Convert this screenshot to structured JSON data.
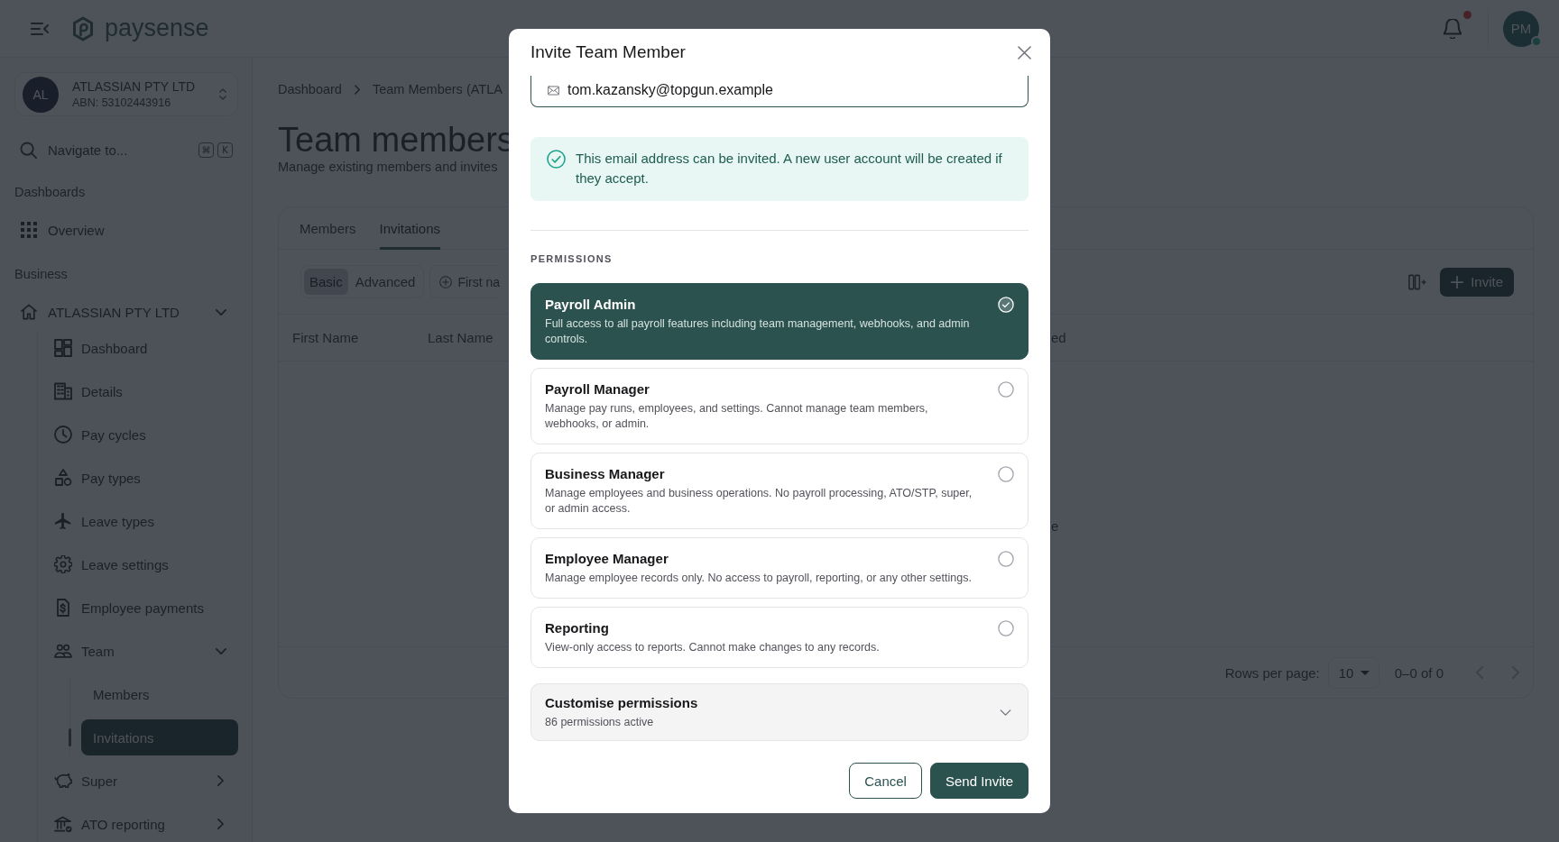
{
  "topbar": {
    "logo_text": "paysense",
    "notifications": {
      "unread": true
    },
    "user": {
      "initials": "PM",
      "online": true
    }
  },
  "sidebar": {
    "organization": {
      "initials": "AL",
      "name": "ATLASSIAN PTY LTD",
      "abn": "ABN: 53102443916"
    },
    "navigate": {
      "label": "Navigate to...",
      "shortcut": [
        "⌘",
        "K"
      ]
    },
    "sections": [
      {
        "label": "Dashboards",
        "items": [
          {
            "label": "Overview",
            "selected": false
          }
        ]
      },
      {
        "label": "Business",
        "items": [
          {
            "label": "ATLASSIAN PTY LTD",
            "selected": false,
            "expanded": true,
            "children": [
              {
                "label": "Dashboard",
                "selected": false
              },
              {
                "label": "Details",
                "selected": false
              },
              {
                "label": "Pay cycles",
                "selected": false
              },
              {
                "label": "Pay types",
                "selected": false
              },
              {
                "label": "Leave types",
                "selected": false
              },
              {
                "label": "Leave settings",
                "selected": false
              },
              {
                "label": "Employee payments",
                "selected": false
              },
              {
                "label": "Team",
                "selected": false,
                "expanded": true,
                "children": [
                  {
                    "label": "Members",
                    "selected": false
                  },
                  {
                    "label": "Invitations",
                    "selected": true
                  }
                ]
              },
              {
                "label": "Super",
                "selected": false,
                "expanded": false
              },
              {
                "label": "ATO reporting",
                "selected": false,
                "expanded": false
              }
            ]
          }
        ]
      }
    ]
  },
  "main": {
    "breadcrumb": [
      {
        "label": "Dashboard"
      },
      {
        "label": "Team Members (ATLA"
      }
    ],
    "title": "Team members",
    "subtitle": "Manage existing members and invites",
    "tabs": [
      {
        "label": "Members",
        "selected": false
      },
      {
        "label": "Invitations",
        "selected": true
      }
    ],
    "filter_modes": [
      {
        "label": "Basic",
        "selected": true
      },
      {
        "label": "Advanced",
        "selected": false
      }
    ],
    "filter_chip": "First na",
    "invite_button": "Invite",
    "table": {
      "columns": [
        "First Name",
        "Last Name",
        "ed"
      ],
      "empty_message": "e"
    },
    "pagination": {
      "rows_per_page_label": "Rows per page:",
      "rows_per_page": "10",
      "range": "0–0 of 0",
      "previous": {
        "disabled": true
      },
      "next": {
        "disabled": true
      }
    }
  },
  "modal": {
    "title": "Invite Team Member",
    "email": {
      "value": "tom.kazansky@topgun.example"
    },
    "alert": {
      "kind": "success",
      "text": "This email address can be invited. A new user account will be created if they accept."
    },
    "permissions_label": "PERMISSIONS",
    "roles": [
      {
        "name": "Payroll Admin",
        "description": "Full access to all payroll features including team management, webhooks, and admin controls.",
        "selected": true
      },
      {
        "name": "Payroll Manager",
        "description": "Manage pay runs, employees, and settings. Cannot manage team members, webhooks, or admin.",
        "selected": false
      },
      {
        "name": "Business Manager",
        "description": "Manage employees and business operations. No payroll processing, ATO/STP, super, or admin access.",
        "selected": false
      },
      {
        "name": "Employee Manager",
        "description": "Manage employee records only. No access to payroll, reporting, or any other settings.",
        "selected": false
      },
      {
        "name": "Reporting",
        "description": "View-only access to reports. Cannot make changes to any records.",
        "selected": false
      }
    ],
    "customise": {
      "title": "Customise permissions",
      "summary": "86 permissions active",
      "expanded": false
    },
    "buttons": [
      {
        "label": "Cancel",
        "kind": "secondary"
      },
      {
        "label": "Send Invite",
        "kind": "primary"
      }
    ]
  }
}
